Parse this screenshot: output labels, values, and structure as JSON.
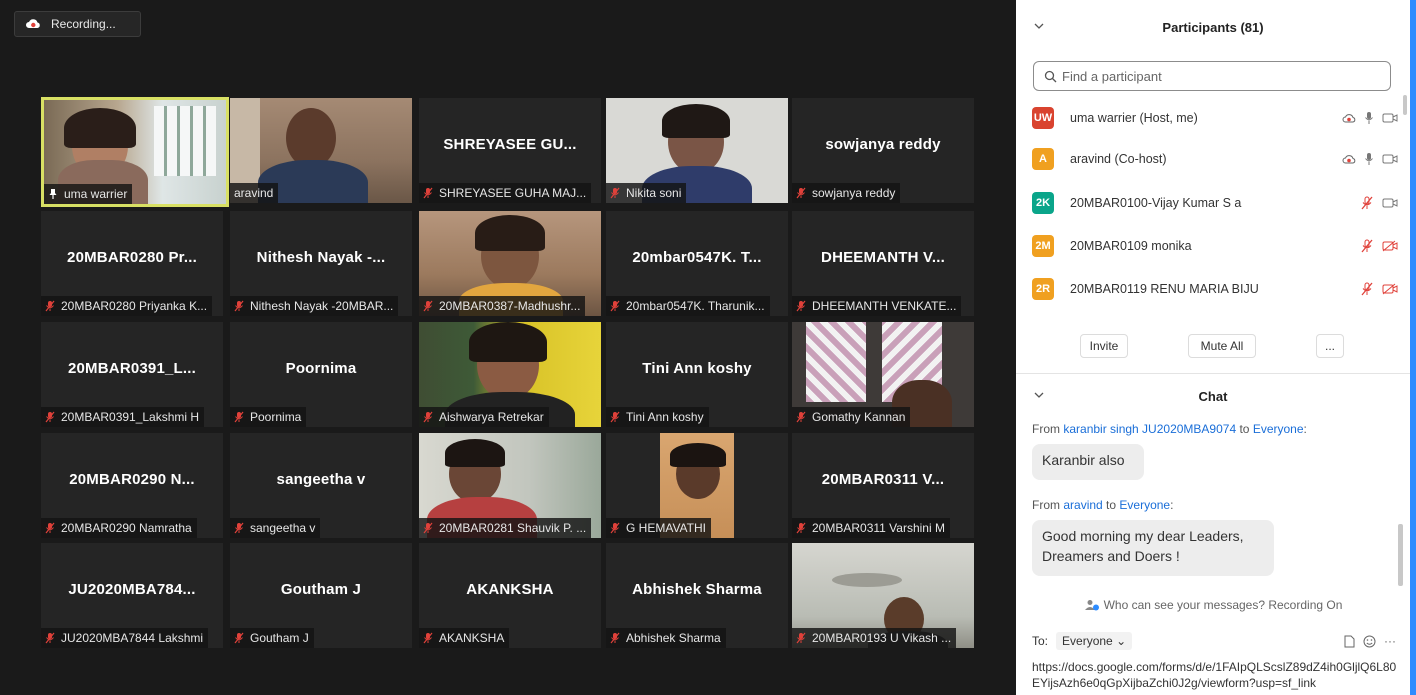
{
  "recording": {
    "label": "Recording..."
  },
  "tiles": [
    {
      "id": "t0",
      "label": "uma warrier",
      "big": "",
      "icon": "pin",
      "active": true
    },
    {
      "id": "t1",
      "label": "aravind",
      "big": "",
      "icon": "none"
    },
    {
      "id": "t2",
      "label": "SHREYASEE GUHA MAJ...",
      "big": "SHREYASEE GU...",
      "icon": "mute"
    },
    {
      "id": "t3",
      "label": "Nikita soni",
      "big": "",
      "icon": "mute"
    },
    {
      "id": "t4",
      "label": "sowjanya reddy",
      "big": "sowjanya reddy",
      "icon": "mute"
    },
    {
      "id": "t5",
      "label": "20MBAR0280 Priyanka K...",
      "big": "20MBAR0280 Pr...",
      "icon": "mute"
    },
    {
      "id": "t6",
      "label": "Nithesh Nayak -20MBAR...",
      "big": "Nithesh Nayak -...",
      "icon": "mute"
    },
    {
      "id": "t7",
      "label": "20MBAR0387-Madhushr...",
      "big": "",
      "icon": "mute"
    },
    {
      "id": "t8",
      "label": "20mbar0547K. Tharunik...",
      "big": "20mbar0547K. T...",
      "icon": "mute"
    },
    {
      "id": "t9",
      "label": "DHEEMANTH VENKATE...",
      "big": "DHEEMANTH V...",
      "icon": "mute"
    },
    {
      "id": "t10",
      "label": "20MBAR0391_Lakshmi H",
      "big": "20MBAR0391_L...",
      "icon": "mute"
    },
    {
      "id": "t11",
      "label": "Poornima",
      "big": "Poornima",
      "icon": "mute"
    },
    {
      "id": "t12",
      "label": "Aishwarya Retrekar",
      "big": "",
      "icon": "mute"
    },
    {
      "id": "t13",
      "label": "Tini Ann koshy",
      "big": "Tini Ann koshy",
      "icon": "mute"
    },
    {
      "id": "t14",
      "label": "Gomathy Kannan",
      "big": "",
      "icon": "mute"
    },
    {
      "id": "t15",
      "label": "20MBAR0290 Namratha",
      "big": "20MBAR0290 N...",
      "icon": "mute"
    },
    {
      "id": "t16",
      "label": "sangeetha v",
      "big": "sangeetha v",
      "icon": "mute"
    },
    {
      "id": "t17",
      "label": "20MBAR0281 Shauvik P. ...",
      "big": "",
      "icon": "mute"
    },
    {
      "id": "t18",
      "label": "G HEMAVATHI",
      "big": "",
      "icon": "mute"
    },
    {
      "id": "t19",
      "label": "20MBAR0311 Varshini M",
      "big": "20MBAR0311 V...",
      "icon": "mute"
    },
    {
      "id": "t20",
      "label": "JU2020MBA7844 Lakshmi",
      "big": "JU2020MBA784...",
      "icon": "mute"
    },
    {
      "id": "t21",
      "label": "Goutham J",
      "big": "Goutham J",
      "icon": "mute"
    },
    {
      "id": "t22",
      "label": "AKANKSHA",
      "big": "AKANKSHA",
      "icon": "mute"
    },
    {
      "id": "t23",
      "label": "Abhishek Sharma",
      "big": "Abhishek Sharma",
      "icon": "mute"
    },
    {
      "id": "t24",
      "label": "20MBAR0193 U Vikash ...",
      "big": "",
      "icon": "mute"
    }
  ],
  "participants": {
    "title": "Participants (81)",
    "search_placeholder": "Find a participant",
    "list": [
      {
        "initials": "UW",
        "name": "uma warrier (Host, me)",
        "color": "#d9432f",
        "rec": true,
        "mic": "on",
        "video": "on"
      },
      {
        "initials": "A",
        "name": "aravind (Co-host)",
        "color": "#f0a020",
        "rec": true,
        "mic": "on",
        "video": "on"
      },
      {
        "initials": "2K",
        "name": "20MBAR0100-Vijay Kumar S a",
        "color": "#0aa58a",
        "rec": false,
        "mic": "muted",
        "video": "on"
      },
      {
        "initials": "2M",
        "name": "20MBAR0109  monika",
        "color": "#f0a020",
        "rec": false,
        "mic": "muted",
        "video": "off"
      },
      {
        "initials": "2R",
        "name": "20MBAR0119 RENU MARIA BIJU",
        "color": "#f0a020",
        "rec": false,
        "mic": "muted",
        "video": "off"
      }
    ],
    "buttons": {
      "invite": "Invite",
      "mute_all": "Mute All",
      "more": "..."
    }
  },
  "chat": {
    "title": "Chat",
    "messages": [
      {
        "from_prefix": "From ",
        "from": "karanbir singh JU2020MBA9074",
        "to_prefix": " to ",
        "to": "Everyone",
        "colon": ":",
        "text": "Karanbir also"
      },
      {
        "from_prefix": "From ",
        "from": "aravind",
        "to_prefix": " to ",
        "to": "Everyone",
        "colon": ":",
        "text": "Good morning my dear Leaders, Dreamers and Doers !"
      }
    ],
    "who_can_see": "Who can see your messages? Recording On",
    "to_label": "To:",
    "to_value": "Everyone",
    "input_text": "https://docs.google.com/forms/d/e/1FAIpQLScslZ89dZ4ih0GljlQ6L80EYijsAzh6e0qGpXijbaZchi0J2g/viewform?usp=sf_link"
  }
}
